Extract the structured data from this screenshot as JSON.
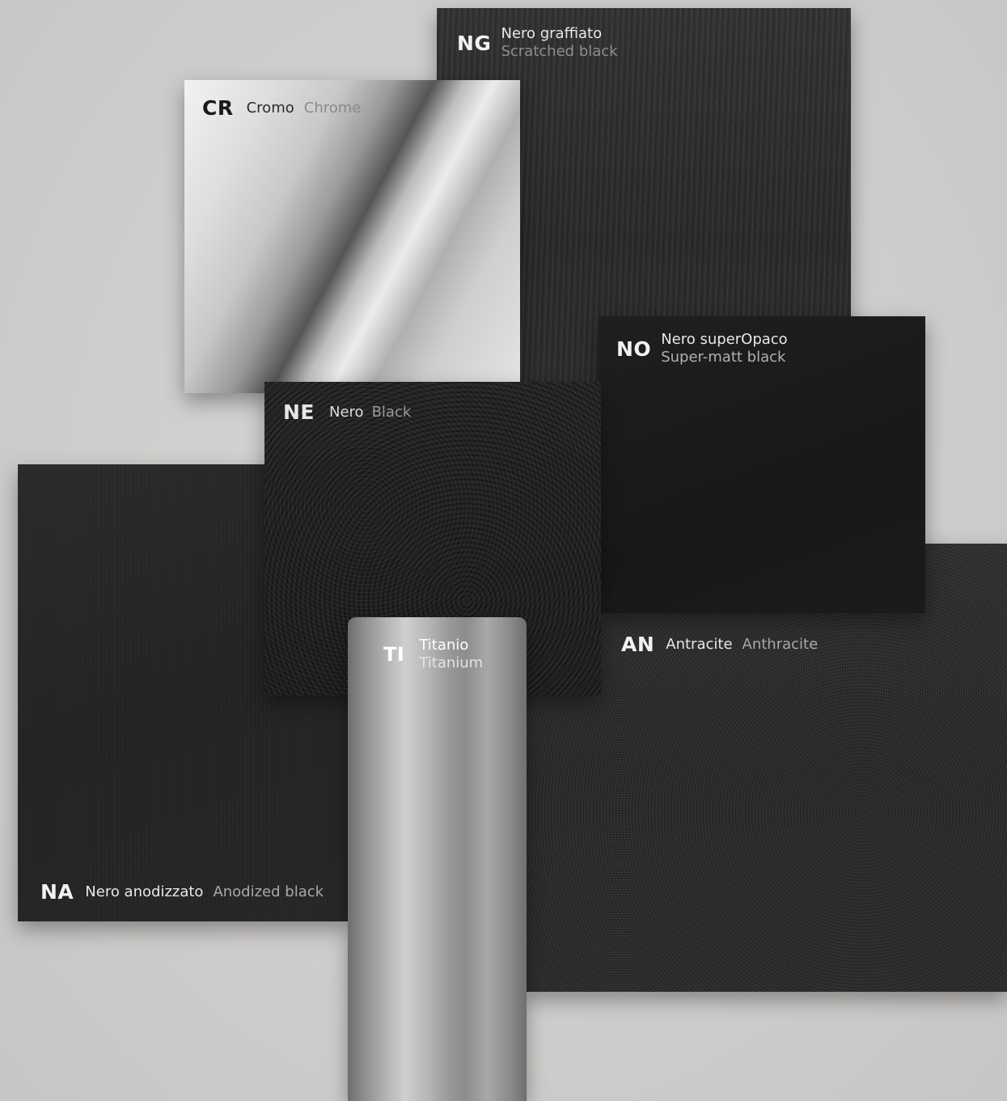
{
  "swatches": {
    "ng": {
      "code": "NG",
      "it": "Nero graffiato",
      "en": "Scratched black"
    },
    "cr": {
      "code": "CR",
      "it": "Cromo",
      "en": "Chrome"
    },
    "no": {
      "code": "NO",
      "it": "Nero superOpaco",
      "en": "Super-matt black"
    },
    "ne": {
      "code": "NE",
      "it": "Nero",
      "en": "Black"
    },
    "ti": {
      "code": "TI",
      "it": "Titanio",
      "en": "Titanium"
    },
    "an": {
      "code": "AN",
      "it": "Antracite",
      "en": "Anthracite"
    },
    "na": {
      "code": "NA",
      "it": "Nero anodizzato",
      "en": "Anodized black"
    }
  }
}
